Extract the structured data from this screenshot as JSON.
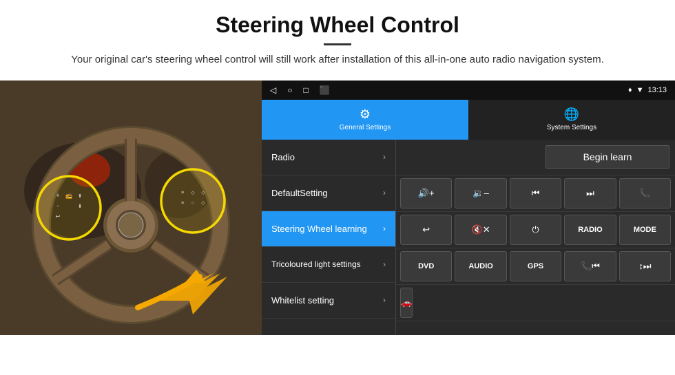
{
  "page": {
    "title": "Steering Wheel Control",
    "divider": true,
    "subtitle": "Your original car's steering wheel control will still work after installation of this all-in-one auto radio navigation system."
  },
  "status_bar": {
    "nav_icons": [
      "◁",
      "○",
      "□",
      "⬛"
    ],
    "right_icons": "♦ ▼",
    "time": "13:13"
  },
  "tabs": [
    {
      "id": "general",
      "icon": "⚙",
      "label": "General Settings",
      "active": true
    },
    {
      "id": "system",
      "icon": "🌐",
      "label": "System Settings",
      "active": false
    }
  ],
  "menu_items": [
    {
      "id": "radio",
      "label": "Radio",
      "active": false
    },
    {
      "id": "default",
      "label": "DefaultSetting",
      "active": false
    },
    {
      "id": "steering",
      "label": "Steering Wheel learning",
      "active": true
    },
    {
      "id": "tricoloured",
      "label": "Tricoloured light settings",
      "active": false
    },
    {
      "id": "whitelist",
      "label": "Whitelist setting",
      "active": false
    }
  ],
  "controls": {
    "begin_learn_label": "Begin learn",
    "rows": [
      [
        {
          "icon": "🔊+",
          "type": "icon"
        },
        {
          "icon": "🔉-",
          "type": "icon"
        },
        {
          "icon": "⏮",
          "type": "icon"
        },
        {
          "icon": "⏭",
          "type": "icon"
        },
        {
          "icon": "📞",
          "type": "icon"
        }
      ],
      [
        {
          "icon": "↩",
          "type": "icon"
        },
        {
          "icon": "🔇✕",
          "type": "icon"
        },
        {
          "icon": "⏻",
          "type": "icon"
        },
        {
          "label": "RADIO",
          "type": "text"
        },
        {
          "label": "MODE",
          "type": "text"
        }
      ],
      [
        {
          "label": "DVD",
          "type": "text"
        },
        {
          "label": "AUDIO",
          "type": "text"
        },
        {
          "label": "GPS",
          "type": "text"
        },
        {
          "icon": "📞⏮",
          "type": "icon"
        },
        {
          "icon": "🔀⏭",
          "type": "icon"
        }
      ]
    ],
    "bottom_row": [
      {
        "icon": "🚗",
        "type": "icon"
      }
    ]
  }
}
